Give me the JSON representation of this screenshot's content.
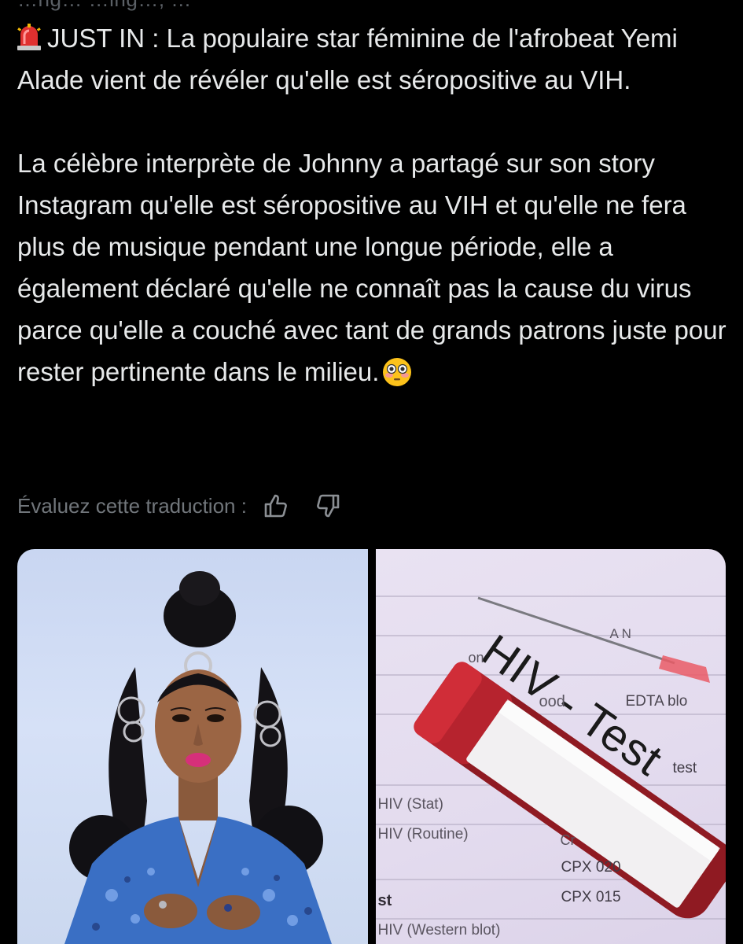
{
  "top_fragment": "…ng…  …ing…, …",
  "post": {
    "paragraph1": "JUST IN : La populaire star féminine de l'afrobeat Yemi Alade vient de révéler qu'elle est séropositive au VIH.",
    "paragraph2": "La célèbre interprète de Johnny a partagé sur son story Instagram qu'elle est séropositive au VIH et qu'elle ne fera plus de musique pendant une longue période, elle a également déclaré qu'elle ne connaît pas la cause du virus parce qu'elle a couché avec tant de grands patrons juste pour rester pertinente dans le milieu.",
    "siren_emoji": "siren-emoji",
    "flushed_emoji": "flushed-face-emoji"
  },
  "rating": {
    "label": "Évaluez cette traduction :",
    "thumbs_up_icon": "thumbs-up-icon",
    "thumbs_down_icon": "thumbs-down-icon"
  },
  "media": {
    "right_image_text": {
      "tube_label": "HIV - Test",
      "lines": {
        "an": "A N",
        "ood": "ood",
        "edta": "EDTA blo",
        "con": "on",
        "test": "test",
        "hiv_stat": "HIV (Stat)",
        "hiv_routine": "HIV (Routine)",
        "cr": "Cr",
        "cpx020": "CPX 020",
        "cpx015": "CPX 015",
        "st": "st",
        "western_blot": "HIV (Western blot)"
      }
    }
  },
  "colors": {
    "background": "#000000",
    "text": "#e7e9ea",
    "secondary_text": "#71767b"
  }
}
